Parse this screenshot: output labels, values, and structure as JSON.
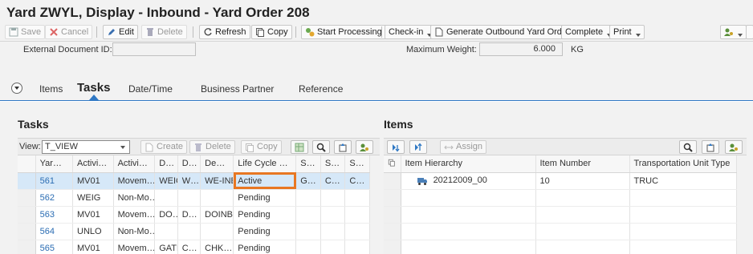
{
  "window": {
    "title": "Yard ZWYL,  Display - Inbound - Yard Order 208"
  },
  "toolbar": {
    "save": "Save",
    "cancel": "Cancel",
    "edit": "Edit",
    "delete": "Delete",
    "refresh": "Refresh",
    "copy": "Copy",
    "start_processing": "Start Processing",
    "check_in": "Check-in",
    "generate_outbound": "Generate Outbound Yard Order",
    "complete": "Complete",
    "print": "Print"
  },
  "header": {
    "ext_doc_label": "External Document ID:",
    "ext_doc_value": "",
    "max_weight_label": "Maximum Weight:",
    "max_weight_value": "6.000",
    "max_weight_unit": "KG"
  },
  "tabs": [
    "Items",
    "Tasks",
    "Date/Time",
    "Business Partner",
    "Reference"
  ],
  "active_tab": "Tasks",
  "tasks": {
    "title": "Tasks",
    "view_label": "View:",
    "view_value": "T_VIEW",
    "create": "Create",
    "delete": "Delete",
    "copy": "Copy",
    "columns": [
      "Yar…",
      "Activi…",
      "Activi…",
      "D…",
      "D…",
      "De…",
      "Life Cycle …",
      "S…",
      "S…",
      "S…"
    ],
    "rows": [
      [
        "561",
        "MV01",
        "Movem…",
        "WEIG",
        "W…",
        "WE-INB",
        "Active",
        "G…",
        "C…",
        "C…"
      ],
      [
        "562",
        "WEIG",
        "Non-Mo…",
        "",
        "",
        "",
        "Pending",
        "",
        "",
        ""
      ],
      [
        "563",
        "MV01",
        "Movem…",
        "DO…",
        "D…",
        "DOINB",
        "Pending",
        "",
        "",
        ""
      ],
      [
        "564",
        "UNLO",
        "Non-Mo…",
        "",
        "",
        "",
        "Pending",
        "",
        "",
        ""
      ],
      [
        "565",
        "MV01",
        "Movem…",
        "GATE",
        "C…",
        "CHK…",
        "Pending",
        "",
        "",
        ""
      ]
    ]
  },
  "items": {
    "title": "Items",
    "assign": "Assign",
    "columns": [
      "Item Hierarchy",
      "Item Number",
      "Transportation Unit Type"
    ],
    "rows": [
      [
        "20212009_00",
        "10",
        "TRUC"
      ],
      [
        "",
        "",
        ""
      ],
      [
        "",
        "",
        ""
      ],
      [
        "",
        "",
        ""
      ],
      [
        "",
        "",
        ""
      ]
    ]
  },
  "colors": {
    "accent": "#2f78c4",
    "highlight": "#e87722",
    "selected_row": "#d6e8f8"
  }
}
